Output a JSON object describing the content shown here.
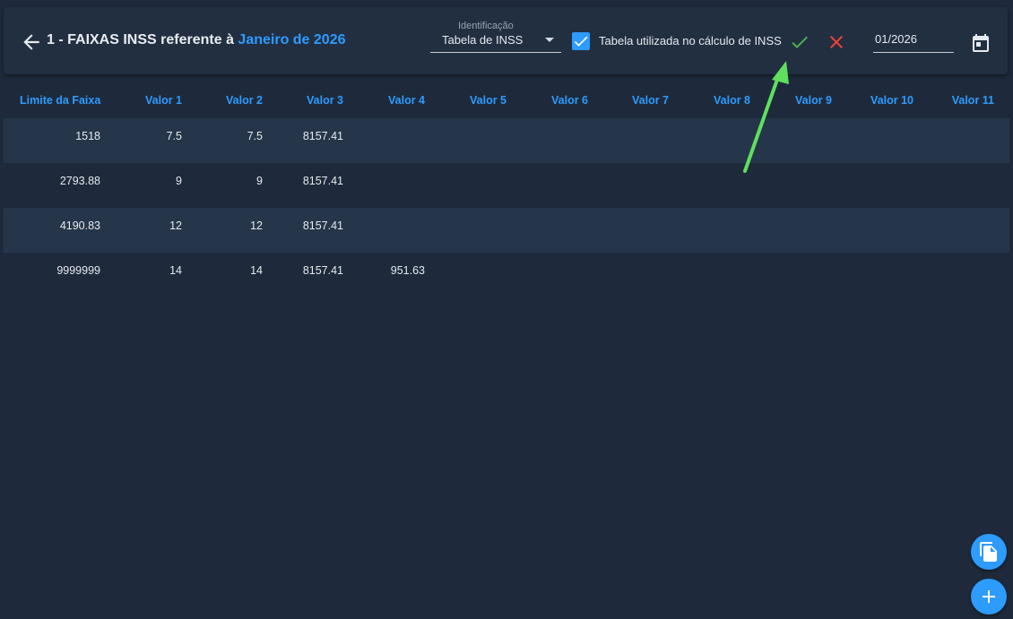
{
  "header": {
    "title_prefix": "1 - FAIXAS INSS referente à",
    "title_month": "Janeiro de 2026",
    "identificacao_label": "Identificação",
    "identificacao_value": "Tabela de INSS",
    "checkbox_checked": true,
    "checkbox_label": "Tabela utilizada no cálculo de INSS",
    "date_value": "01/2026"
  },
  "icons": {
    "back": "arrow-left-icon",
    "confirm": "check-icon",
    "cancel": "close-icon",
    "calendar": "calendar-icon",
    "copy": "copy-icon",
    "add": "plus-icon"
  },
  "colors": {
    "accent": "#2e9bff",
    "confirm": "#4caf50",
    "cancel": "#f44336",
    "annotation_arrow": "#5ee05e"
  },
  "table": {
    "columns": [
      "Limite da Faixa",
      "Valor 1",
      "Valor 2",
      "Valor 3",
      "Valor 4",
      "Valor 5",
      "Valor 6",
      "Valor 7",
      "Valor 8",
      "Valor 9",
      "Valor 10",
      "Valor 11"
    ],
    "rows": [
      [
        "1518",
        "7.5",
        "7.5",
        "8157.41",
        "",
        "",
        "",
        "",
        "",
        "",
        "",
        ""
      ],
      [
        "2793.88",
        "9",
        "9",
        "8157.41",
        "",
        "",
        "",
        "",
        "",
        "",
        "",
        ""
      ],
      [
        "4190.83",
        "12",
        "12",
        "8157.41",
        "",
        "",
        "",
        "",
        "",
        "",
        "",
        ""
      ],
      [
        "9999999",
        "14",
        "14",
        "8157.41",
        "951.63",
        "",
        "",
        "",
        "",
        "",
        "",
        ""
      ]
    ]
  }
}
